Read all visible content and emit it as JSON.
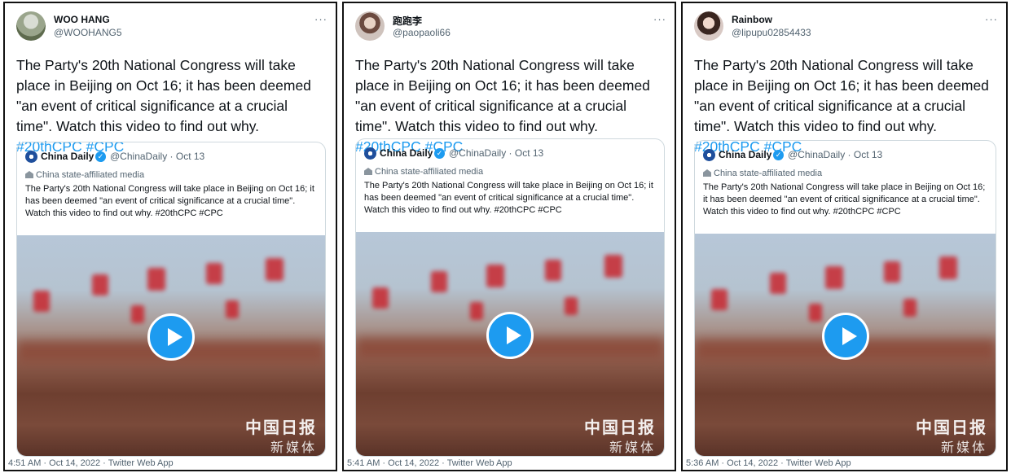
{
  "tweets": [
    {
      "user_name": "WOO HANG",
      "handle": "@WOOHANG5",
      "more": "···",
      "text": "The Party's 20th National Congress will take place in Beijing on Oct 16; it has been deemed \"an event of critical significance at a crucial time\". Watch this video to find out why. ",
      "hashtag_1": "#20thCPC",
      "hashtag_2": "#CPC",
      "footer": "4:51 AM · Oct 14, 2022 · Twitter Web App"
    },
    {
      "user_name": "跑跑李",
      "handle": "@paopaoli66",
      "more": "···",
      "text": "The Party's 20th National Congress will take place in Beijing on Oct 16; it has been deemed \"an event of critical significance at a crucial time\". Watch this video to find out why. ",
      "hashtag_1": "#20thCPC",
      "hashtag_2": "#CPC",
      "footer": "5:41 AM · Oct 14, 2022 · Twitter Web App"
    },
    {
      "user_name": "Rainbow",
      "handle": "@lipupu02854433",
      "more": "···",
      "text": "The Party's 20th National Congress will take place in Beijing on Oct 16; it has been deemed \"an event of critical significance at a crucial time\". Watch this video to find out why. ",
      "hashtag_1": "#20thCPC",
      "hashtag_2": "#CPC",
      "footer": "5:36 AM · Oct 14, 2022 · Twitter Web App"
    }
  ],
  "quoted": {
    "name": "China Daily",
    "handle_date": "@ChinaDaily · Oct 13",
    "state_label": "China state-affiliated media",
    "text": "The Party's 20th National Congress will take place in Beijing on Oct 16; it has been deemed \"an event of critical significance at a crucial time\". Watch this video to find out why. #20thCPC #CPC",
    "watermark_top": "中国日报",
    "watermark_bottom": "新媒体"
  },
  "colors": {
    "link": "#1d9bf0",
    "verified": "#1d9bf0",
    "secondary_text": "#536471"
  },
  "icons": [
    "verified-badge-icon",
    "state-media-icon",
    "play-icon",
    "more-icon"
  ]
}
